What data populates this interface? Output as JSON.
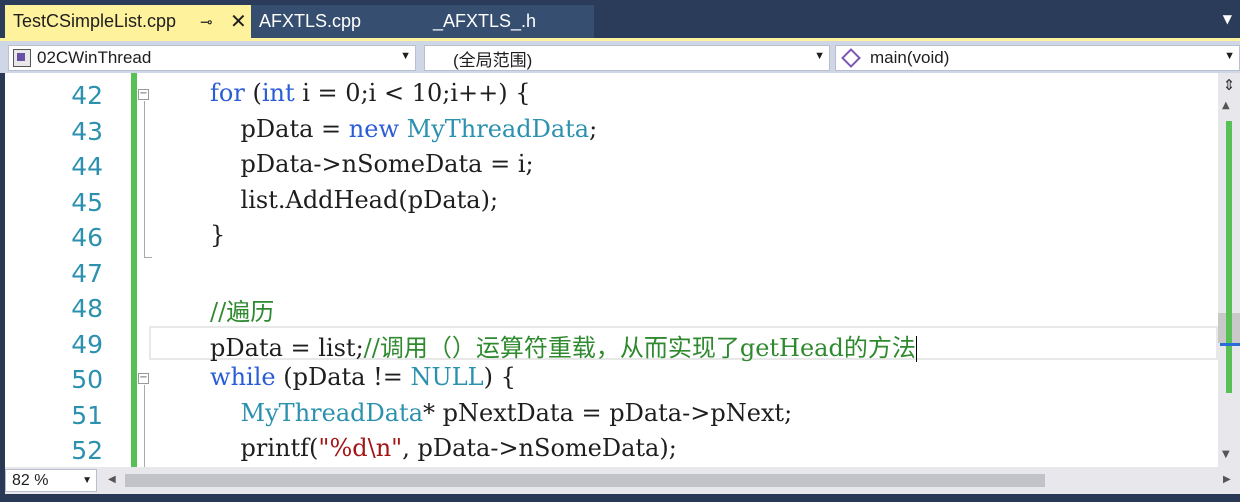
{
  "tabs": [
    {
      "label": "TestCSimpleList.cpp",
      "pin": "⊸",
      "close": "✕"
    },
    {
      "label": "AFXTLS.cpp"
    },
    {
      "label": "_AFXTLS_.h"
    }
  ],
  "navbar": {
    "project": "02CWinThread",
    "scope": "(全局范围)",
    "member": "main(void)"
  },
  "editor": {
    "lines": [
      {
        "n": "42"
      },
      {
        "n": "43"
      },
      {
        "n": "44"
      },
      {
        "n": "45"
      },
      {
        "n": "46"
      },
      {
        "n": "47"
      },
      {
        "n": "48"
      },
      {
        "n": "49"
      },
      {
        "n": "50"
      },
      {
        "n": "51"
      },
      {
        "n": "52"
      }
    ],
    "code": {
      "l42": {
        "i": "        ",
        "kw1": "for",
        "t1": " (",
        "kw2": "int",
        "t2": " i = 0;i < 10;i++) {"
      },
      "l43": {
        "i": "            ",
        "t1": "pData = ",
        "kw": "new",
        "t2": " ",
        "ty": "MyThreadData",
        "t3": ";"
      },
      "l44": {
        "i": "            ",
        "t1": "pData->nSomeData = i;"
      },
      "l45": {
        "i": "            ",
        "t1": "list.AddHead(pData);"
      },
      "l46": {
        "i": "        ",
        "t1": "}"
      },
      "l48": {
        "i": "        ",
        "cm": "//遍历"
      },
      "l49": {
        "i": "        ",
        "t1": "pData = list;",
        "cm": "//调用（）运算符重载，从而实现了getHead的方法"
      },
      "l50": {
        "i": "        ",
        "kw": "while",
        "t1": " (pData != ",
        "ty": "NULL",
        "t2": ") {"
      },
      "l51": {
        "i": "            ",
        "ty": "MyThreadData",
        "t1": "* pNextData = pData->pNext;"
      },
      "l52": {
        "i": "            ",
        "t1": "printf(",
        "st": "\"%d\\n\"",
        "t2": ", pData->nSomeData);"
      }
    }
  },
  "zoom": "82 %",
  "colors": {
    "active_tab": "#fff29d",
    "keyword": "#2b5cd8",
    "type": "#2b91af",
    "comment": "#2f8a2f",
    "change_bar": "#57c157"
  }
}
